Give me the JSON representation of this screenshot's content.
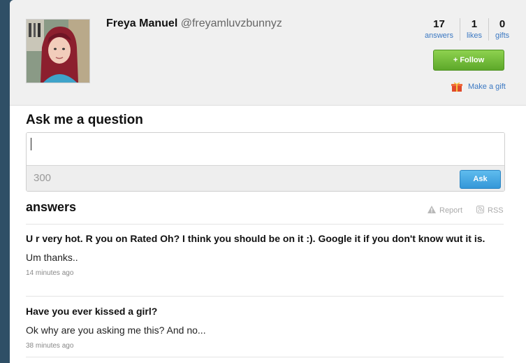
{
  "profile": {
    "name": "Freya Manuel",
    "username": "@freyamluvzbunnyz",
    "avatar_icon": "profile-photo"
  },
  "stats": [
    {
      "count": "17",
      "label": "answers"
    },
    {
      "count": "1",
      "label": "likes"
    },
    {
      "count": "0",
      "label": "gifts"
    }
  ],
  "actions": {
    "follow_label": "+ Follow",
    "gift_label": "Make a gift",
    "gift_icon": "gift-icon"
  },
  "ask": {
    "title": "Ask me a question",
    "input_value": "",
    "char_count": "300",
    "ask_label": "Ask"
  },
  "answers_section": {
    "title": "answers",
    "report_label": "Report",
    "rss_label": "RSS"
  },
  "answers": [
    {
      "question": "U r very hot. R you on Rated Oh? I think you should be on it :). Google it if you don't know wut it is.",
      "answer": "Um thanks..",
      "time": "14 minutes ago"
    },
    {
      "question": "Have you ever kissed a girl?",
      "answer": "Ok why are you asking me this? And no...",
      "time": "38 minutes ago"
    }
  ],
  "colors": {
    "background": "#2f4f66",
    "link": "#3b78c2",
    "follow_green": "#6cb634",
    "ask_blue": "#3497d8"
  }
}
